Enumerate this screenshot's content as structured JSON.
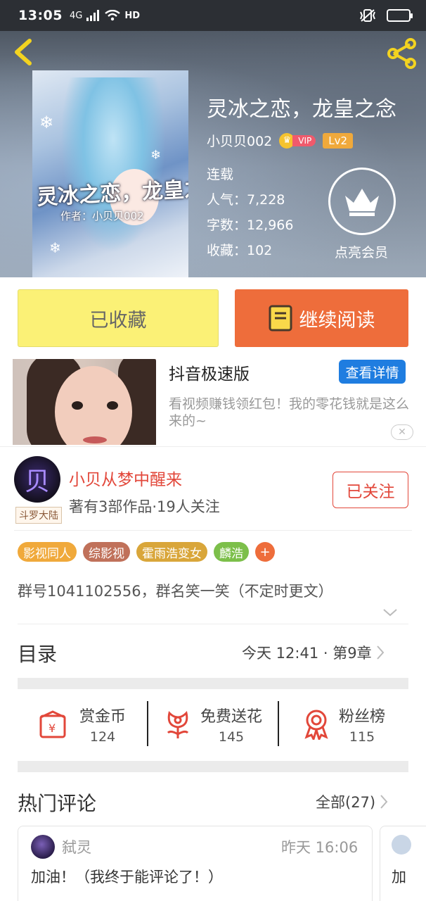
{
  "status_bar": {
    "time": "13:05",
    "network": "4G",
    "hd": "HD"
  },
  "book": {
    "title": "灵冰之恋，龙皇之念",
    "cover_title": "灵冰之恋，龙皇之念",
    "cover_author": "作者：小贝贝002",
    "author": "小贝贝002",
    "vip_label": "VIP",
    "level": "Lv2",
    "status": "连载",
    "popularity": "人气：7,228",
    "words": "字数：12,966",
    "favorites": "收藏：102",
    "member_label": "点亮会员"
  },
  "actions": {
    "collected": "已收藏",
    "continue": "继续阅读"
  },
  "ad": {
    "title": "抖音极速版",
    "button": "查看详情",
    "description": "看视频赚钱领红包！我的零花钱就是这么来的~",
    "close": "✕"
  },
  "author_card": {
    "name": "小贝从梦中醒来",
    "stats": "著有3部作品·19人关注",
    "tag": "斗罗大陆",
    "follow": "已关注",
    "avatar_glyph": "贝"
  },
  "tags": [
    {
      "label": "影视同人",
      "color": "#f0a93b"
    },
    {
      "label": "综影视",
      "color": "#c0715a"
    },
    {
      "label": "霍雨浩变女",
      "color": "#d9a63a"
    },
    {
      "label": "麟浩",
      "color": "#7cbf4a"
    }
  ],
  "tag_add": "+",
  "intro": "群号1041102556，群名笑一笑（不定时更文）",
  "toc": {
    "title": "目录",
    "latest": "今天 12:41 · 第9章"
  },
  "stats": [
    {
      "label": "赏金币",
      "value": "124",
      "icon": "reward-coin-icon"
    },
    {
      "label": "免费送花",
      "value": "145",
      "icon": "flower-icon"
    },
    {
      "label": "粉丝榜",
      "value": "115",
      "icon": "medal-icon"
    }
  ],
  "comments_section": {
    "title": "热门评论",
    "all": "全部(27)"
  },
  "comments": [
    {
      "user": "弑灵",
      "time": "昨天 16:06",
      "text": "加油！（我终于能评论了！）"
    },
    {
      "text": "加"
    }
  ],
  "colors": {
    "accent": "#ee6d3b",
    "red": "#e2473a",
    "blue": "#1f7de0",
    "yellow": "#fbf176"
  }
}
